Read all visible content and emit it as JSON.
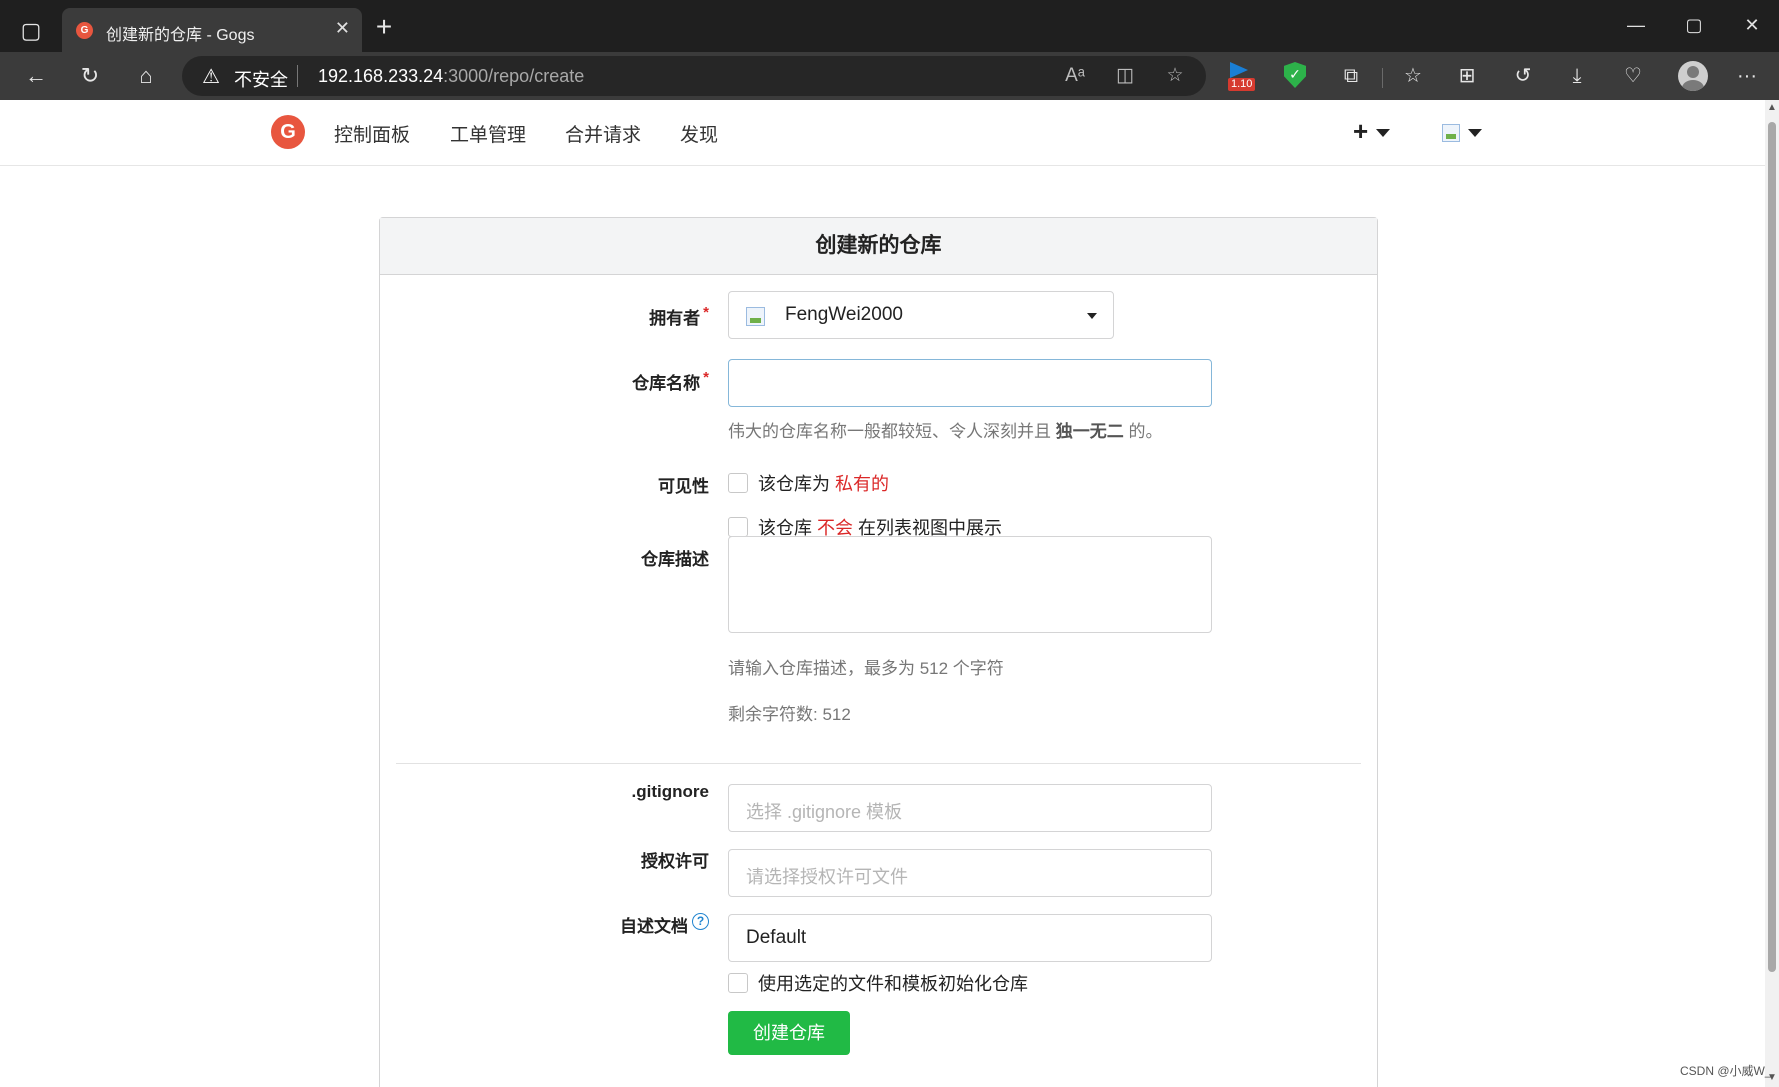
{
  "browser": {
    "tab_title": "创建新的仓库 - Gogs",
    "tab_favicon": "G",
    "security_label": "不安全",
    "url_host": "192.168.233.24",
    "url_path": ":3000/repo/create",
    "extension_badge": "1.10"
  },
  "nav": {
    "items": [
      "控制面板",
      "工单管理",
      "合并请求",
      "发现"
    ],
    "plus": "+"
  },
  "form": {
    "heading": "创建新的仓库",
    "owner_label": "拥有者",
    "owner_value": "FengWei2000",
    "required_mark": "*",
    "repo_name_label": "仓库名称",
    "repo_name_value": "",
    "repo_name_help_prefix": "伟大的仓库名称一般都较短、令人深刻并且 ",
    "repo_name_help_bold": "独一无二",
    "repo_name_help_suffix": " 的。",
    "visibility_label": "可见性",
    "private_prefix": "该仓库为 ",
    "private_highlight": "私有的",
    "unlisted_prefix": "该仓库 ",
    "unlisted_highlight": "不会",
    "unlisted_suffix": " 在列表视图中展示",
    "description_label": "仓库描述",
    "description_help": "请输入仓库描述，最多为 512 个字符",
    "remaining_chars": "剩余字符数: 512",
    "gitignore_label": ".gitignore",
    "gitignore_placeholder": "选择 .gitignore 模板",
    "license_label": "授权许可",
    "license_placeholder": "请选择授权许可文件",
    "readme_label": "自述文档",
    "readme_help_icon": "?",
    "readme_value": "Default",
    "auto_init_label": "使用选定的文件和模板初始化仓库",
    "submit_label": "创建仓库"
  },
  "watermark": "CSDN @小威W_",
  "colors": {
    "accent_green": "#21ba45",
    "required_red": "#db2828",
    "logo_orange": "#e8563f"
  }
}
